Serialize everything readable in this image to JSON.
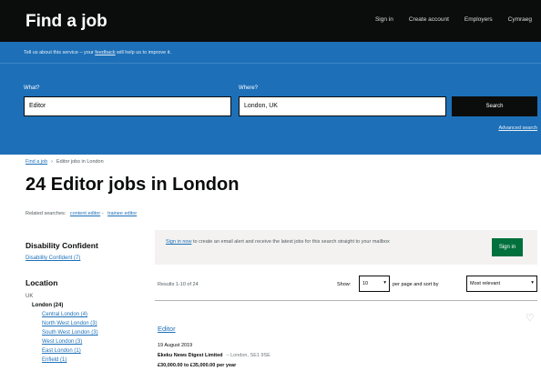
{
  "header": {
    "logo": "Find a job",
    "nav": [
      "Sign in",
      "Create account",
      "Employers",
      "Cymraeg"
    ]
  },
  "feedback": {
    "prefix": "Tell us about this service – your",
    "link": "feedback",
    "suffix": "will help us to improve it."
  },
  "search": {
    "what_label": "What?",
    "what_value": "Editor",
    "where_label": "Where?",
    "where_value": "London, UK",
    "button": "Search",
    "advanced_link": "Advanced search"
  },
  "breadcrumb": {
    "home": "Find a job",
    "current": "Editor jobs in London"
  },
  "page_title": "24 Editor jobs in London",
  "related": {
    "label": "Related searches:",
    "links": [
      "content editor",
      "trainee editor"
    ]
  },
  "sidebar": {
    "disability_heading": "Disability Confident",
    "disability_link": "Disability Confident (7)",
    "location_heading": "Location",
    "uk": "UK",
    "london": "London (24)",
    "areas": [
      "Central London (4)",
      "North West London (3)",
      "South West London (3)",
      "West London (3)",
      "East London (1)",
      "Enfield (1)"
    ]
  },
  "alert": {
    "link": "Sign in now",
    "text": "to create an email alert and receive the latest jobs for this search straight to your mailbox",
    "button": "Sign in"
  },
  "results": {
    "count": "Results 1-10 of 24",
    "show_label": "Show:",
    "per_page_value": "10",
    "per_page_suffix": "per page and sort by",
    "sort_value": "Most relevant"
  },
  "job": {
    "title": "Editor",
    "date": "19 August 2019",
    "company": "Ekeku News Digest Limited",
    "location": "– London, SE1 9SE",
    "salary": "£30,000.00 to £35,000.00 per year"
  },
  "colors": {
    "header_bg": "#0b0c0c",
    "search_bg": "#1d70b8",
    "link": "#1d70b8",
    "signin_green": "#00703c"
  },
  "icons": [
    "chevron-down-icon",
    "heart-icon"
  ]
}
